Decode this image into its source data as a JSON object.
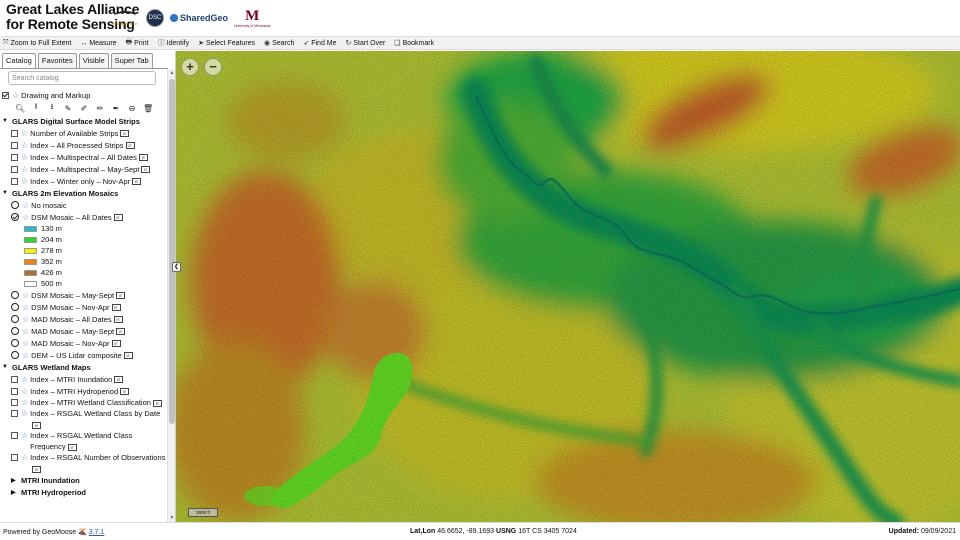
{
  "header": {
    "title_line1": "Great Lakes Alliance",
    "title_line2": "for Remote Sensing",
    "logos": {
      "mtu": "Michigan Tech",
      "dsc": "DSC",
      "sharedgeo": "SharedGeo",
      "umn_letter": "M",
      "umn": "University of Minnesota"
    }
  },
  "toolbar": {
    "items": [
      {
        "label": "Zoom to Full Extent",
        "icon": "zoom-extent-icon",
        "glyph": "⤧"
      },
      {
        "label": "Measure",
        "icon": "measure-icon",
        "glyph": "↔"
      },
      {
        "label": "Print",
        "icon": "print-icon",
        "glyph": "🖶"
      },
      {
        "label": "Identify",
        "icon": "info-icon",
        "glyph": "ⓘ"
      },
      {
        "label": "Select Features",
        "icon": "select-pointer-icon",
        "glyph": "➤"
      },
      {
        "label": "Search",
        "icon": "search-icon",
        "glyph": "◉"
      },
      {
        "label": "Find Me",
        "icon": "location-arrow-icon",
        "glyph": "➶"
      },
      {
        "label": "Start Over",
        "icon": "refresh-icon",
        "glyph": "↻"
      },
      {
        "label": "Bookmark",
        "icon": "bookmark-icon",
        "glyph": "❏"
      }
    ]
  },
  "sidebar": {
    "tabs": [
      {
        "label": "Catalog",
        "active": true
      },
      {
        "label": "Favorites",
        "active": false
      },
      {
        "label": "Visible",
        "active": false
      },
      {
        "label": "Super Tab",
        "active": false
      }
    ],
    "search_placeholder": "Search catalog",
    "drawing": {
      "label": "Drawing and Markup"
    },
    "groups": {
      "dsm_strips": {
        "title": "GLARS Digital Surface Model Strips",
        "items": [
          "Number of Available Strips",
          "Index – All Processed Strips",
          "Index – Multispectral – All Dates",
          "Index – Multispectral – May-Sept",
          "Index – Winter only – Nov-Apr"
        ]
      },
      "elevation": {
        "title": "GLARS 2m Elevation Mosaics",
        "no_mosaic": "No mosaic",
        "selected": "DSM Mosaic – All Dates",
        "legend": [
          {
            "label": "130 m",
            "color": "#2bb8c8"
          },
          {
            "label": "204 m",
            "color": "#2fd22f"
          },
          {
            "label": "278 m",
            "color": "#f4f400"
          },
          {
            "label": "352 m",
            "color": "#e8841e"
          },
          {
            "label": "426 m",
            "color": "#b07030"
          },
          {
            "label": "500 m",
            "color": "#ffffff"
          }
        ],
        "items": [
          "DSM Mosaic – May-Sept",
          "DSM Mosaic – Nov-Apr",
          "MAD Mosaic – All Dates",
          "MAD Mosaic – May-Sept",
          "MAD Mosaic – Nov-Apr",
          "DEM – US Lidar composite"
        ]
      },
      "wetland": {
        "title": "GLARS Wetland Maps",
        "items": [
          "Index – MTRI Inundation",
          "Index – MTRI Hydroperiod",
          "Index – MTRI Wetland Classification",
          "Index – RSGAL Wetland Class by Date",
          "Index – RSGAL Wetland Class Frequency",
          "Index – RSGAL Number of Observations"
        ]
      },
      "mtri_inundation": {
        "title": "MTRI Inundation"
      },
      "mtri_hydroperiod": {
        "title": "MTRI Hydroperiod"
      }
    }
  },
  "map": {
    "zoom_in": "+",
    "zoom_out": "−",
    "scale_label": "3000 ft",
    "collapse_glyph": "❮"
  },
  "footer": {
    "powered_by": "Powered by GeoMoose",
    "version": "3.7.1",
    "latlon_label": "Lat,Lon",
    "latlon_value": "46.6652, -89.1693",
    "usng_label": "USNG",
    "usng_value": "16T CS 3405 7024",
    "updated_label": "Updated:",
    "updated_value": "09/09/2021"
  },
  "colors": {
    "valley_green": "#18a04a",
    "upland_yellow": "#c8d43a",
    "ridge_orange": "#d87a2a",
    "lake_green": "#5ef02a",
    "link_blue": "#2660b4"
  }
}
